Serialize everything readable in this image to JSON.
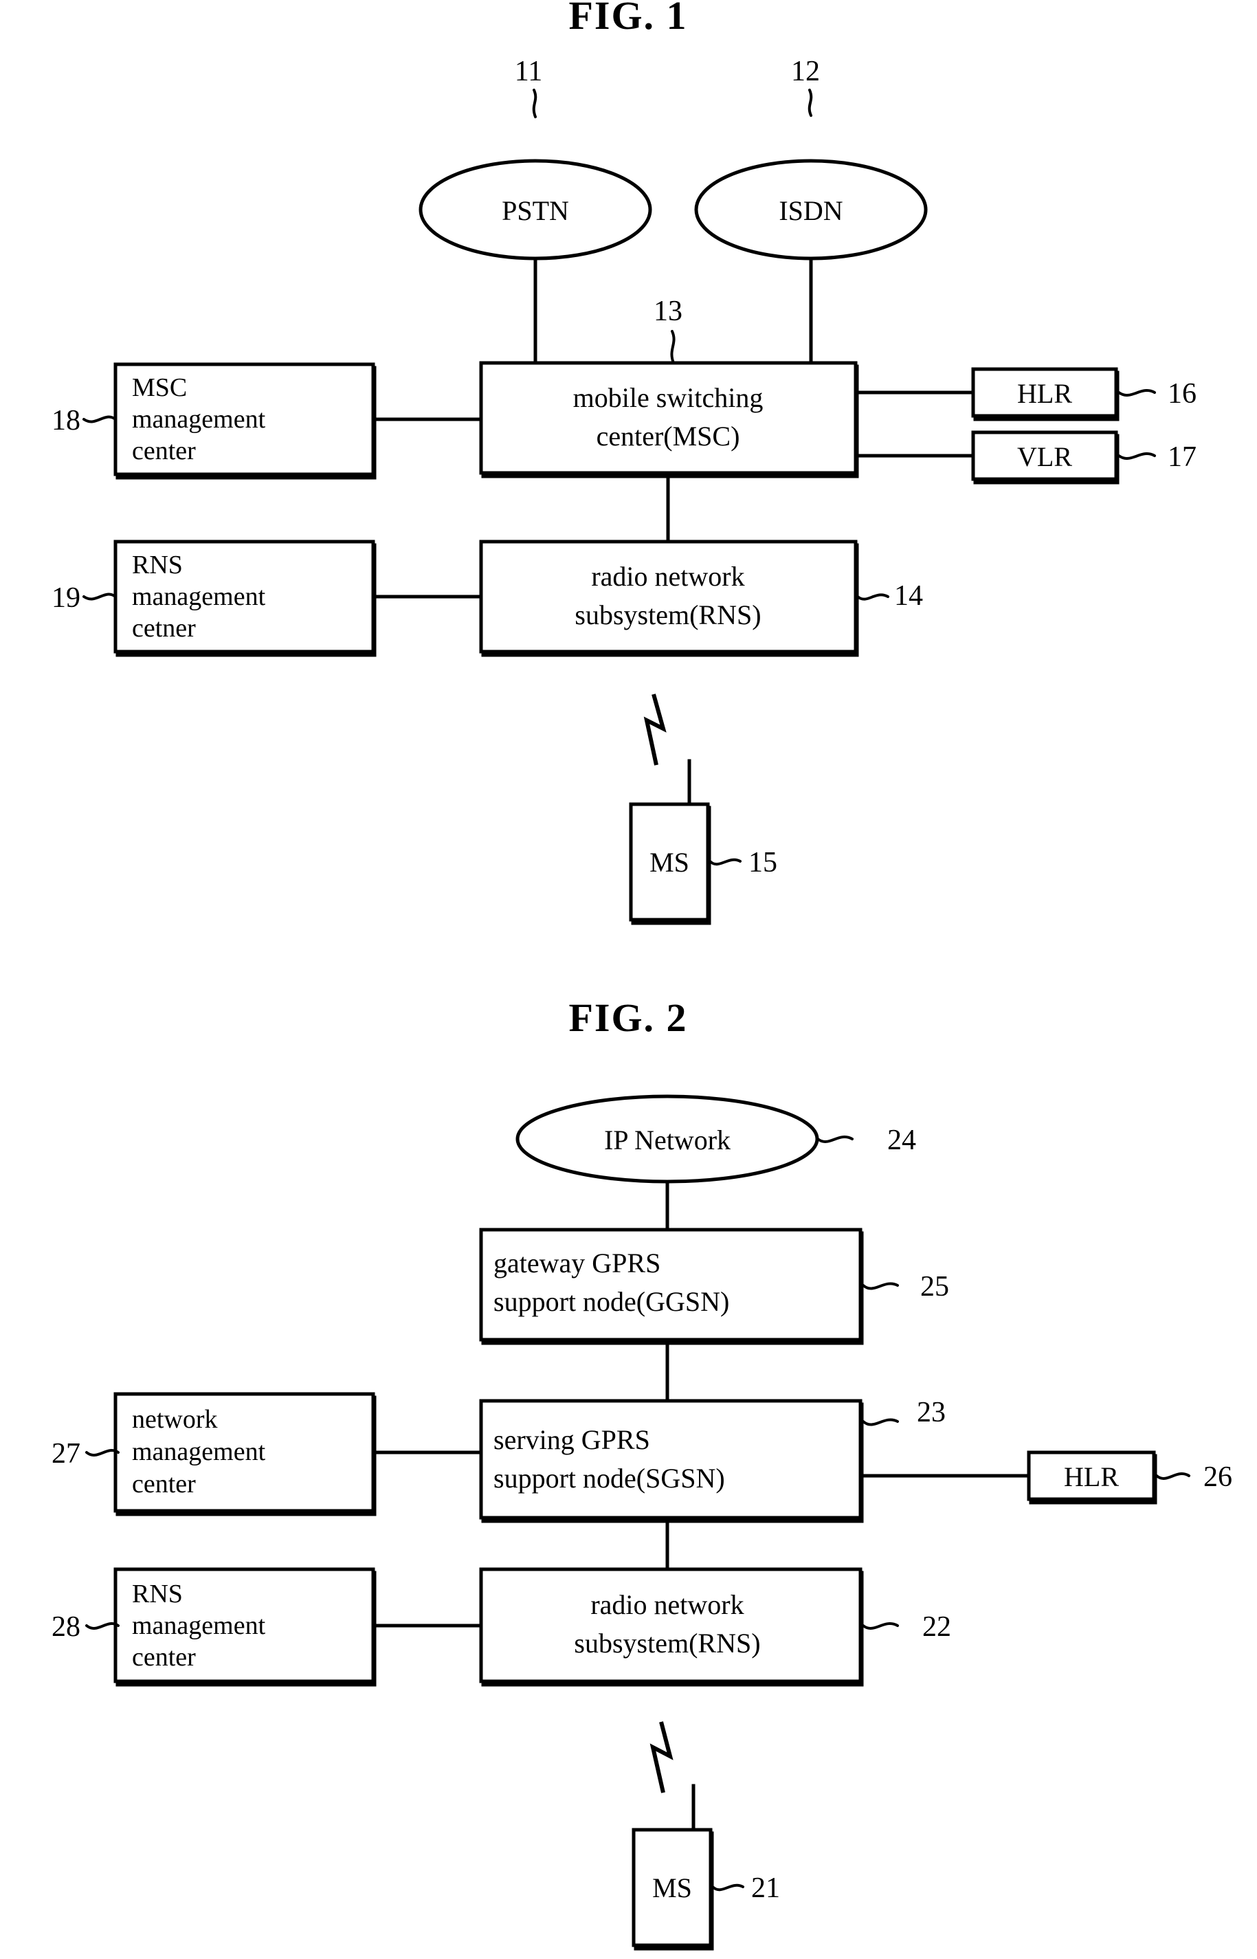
{
  "page": {
    "background": "#ffffff",
    "ink": "#000000"
  },
  "figures": [
    {
      "id": "fig1",
      "title": "FIG. 1",
      "nodes": {
        "pstn": {
          "label": "PSTN",
          "ref": "11",
          "shape": "ellipse"
        },
        "isdn": {
          "label": "ISDN",
          "ref": "12",
          "shape": "ellipse"
        },
        "msc": {
          "label_line1": "mobile switching",
          "label_line2": "center(MSC)",
          "ref": "13",
          "shape": "box"
        },
        "rns": {
          "label_line1": "radio network",
          "label_line2": "subsystem(RNS)",
          "ref": "14",
          "shape": "box"
        },
        "ms": {
          "label": "MS",
          "ref": "15",
          "shape": "box"
        },
        "hlr": {
          "label": "HLR",
          "ref": "16",
          "shape": "box"
        },
        "vlr": {
          "label": "VLR",
          "ref": "17",
          "shape": "box"
        },
        "msc_mgmt": {
          "label_line1": "MSC",
          "label_line2": "management",
          "label_line3": "center",
          "ref": "18",
          "shape": "box"
        },
        "rns_mgmt": {
          "label_line1": "RNS",
          "label_line2": "management",
          "label_line3": "cetner",
          "ref": "19",
          "shape": "box"
        }
      }
    },
    {
      "id": "fig2",
      "title": "FIG. 2",
      "nodes": {
        "ip_network": {
          "label": "IP Network",
          "ref": "24",
          "shape": "ellipse"
        },
        "ggsn": {
          "label_line1": "gateway GPRS",
          "label_line2": "support node(GGSN)",
          "ref": "25",
          "shape": "box"
        },
        "sgsn": {
          "label_line1": "serving GPRS",
          "label_line2": "support node(SGSN)",
          "ref": "23",
          "shape": "box"
        },
        "rns": {
          "label_line1": "radio network",
          "label_line2": "subsystem(RNS)",
          "ref": "22",
          "shape": "box"
        },
        "ms": {
          "label": "MS",
          "ref": "21",
          "shape": "box"
        },
        "hlr": {
          "label": "HLR",
          "ref": "26",
          "shape": "box"
        },
        "net_mgmt": {
          "label_line1": "network",
          "label_line2": "management",
          "label_line3": "center",
          "ref": "27",
          "shape": "box"
        },
        "rns_mgmt": {
          "label_line1": "RNS",
          "label_line2": "management",
          "label_line3": "center",
          "ref": "28",
          "shape": "box"
        }
      }
    }
  ]
}
